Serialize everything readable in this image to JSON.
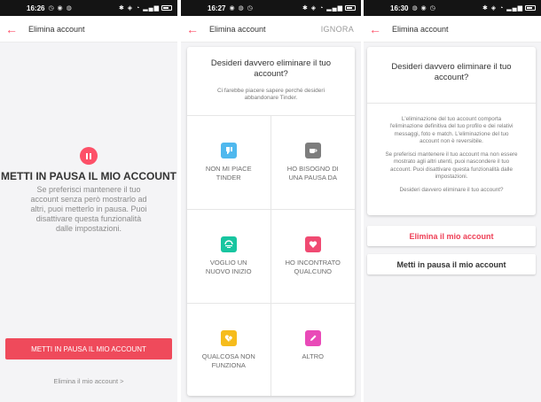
{
  "screens": [
    {
      "status": {
        "time": "16:26"
      },
      "appbar": {
        "title": "Elimina account"
      },
      "title": "METTI IN PAUSA IL MIO ACCOUNT",
      "description": "Se preferisci mantenere il tuo account senza però mostrarlo ad altri, puoi metterlo in pausa. Puoi disattivare questa funzionalità dalle impostazioni.",
      "primary_button": "METTI IN PAUSA IL MIO ACCOUNT",
      "delete_link": "Elimina il mio account >"
    },
    {
      "status": {
        "time": "16:27"
      },
      "appbar": {
        "title": "Elimina account",
        "action": "IGNORA"
      },
      "question": "Desideri davvero eliminare il tuo account?",
      "subtitle": "Ci farebbe piacere sapere perché desideri abbandonare Tinder.",
      "reasons": [
        {
          "label": "NON MI PIACE TINDER",
          "icon": "thumbs-down-icon",
          "color": "#4fb8ee"
        },
        {
          "label": "HO BISOGNO DI UNA PAUSA DA",
          "icon": "coffee-cup-icon",
          "color": "#7d7d7d"
        },
        {
          "label": "VOGLIO UN NUOVO INIZIO",
          "icon": "fresh-start-icon",
          "color": "#18c5a0"
        },
        {
          "label": "HO INCONTRATO QUALCUNO",
          "icon": "heart-icon",
          "color": "#f04a72"
        },
        {
          "label": "QUALCOSA NON FUNZIONA",
          "icon": "broken-heart-icon",
          "color": "#f6bc1c"
        },
        {
          "label": "ALTRO",
          "icon": "pencil-icon",
          "color": "#e94ab8"
        }
      ]
    },
    {
      "status": {
        "time": "16:30"
      },
      "appbar": {
        "title": "Elimina account"
      },
      "question": "Desideri davvero eliminare il tuo account?",
      "paragraphs": [
        "L'eliminazione del tuo account comporta l'eliminazione definitiva del tuo profilo e dei relativi messaggi, foto e match. L'eliminazione del tuo account non è reversibile.",
        "Se preferisci mantenere il tuo account ma non essere mostrato agli altri utenti, puoi nascondere il tuo account. Puoi disattivare questa funzionalità dalle impostazioni.",
        "Desideri davvero eliminare il tuo account?"
      ],
      "delete_button": "Elimina il mio account",
      "pause_button": "Metti in pausa il mio account"
    }
  ],
  "colors": {
    "accent": "#fd5068",
    "button_red": "#ef4a5b",
    "background": "#f4f4f6"
  }
}
